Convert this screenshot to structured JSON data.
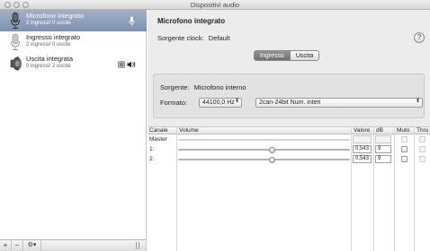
{
  "window": {
    "title": "Dispositivi audio"
  },
  "sidebar": {
    "devices": [
      {
        "name": "Microfono integrato",
        "sub": "2 ingressi/ 0 uscite",
        "icon": "microphone-icon",
        "selected": true
      },
      {
        "name": "Ingresso integrato",
        "sub": "2 ingressi/ 0 uscite",
        "icon": "line-in-icon",
        "selected": false
      },
      {
        "name": "Uscita integrata",
        "sub": "0 ingressi/ 2 uscite",
        "icon": "speaker-icon",
        "selected": false
      }
    ],
    "bottom": {
      "add": "+",
      "remove": "−",
      "gear": "⚙▾"
    }
  },
  "detail": {
    "title": "Microfono integrato",
    "clock_label": "Sorgente clock:",
    "clock_value": "Default",
    "help": "?",
    "tabs": [
      {
        "label": "Ingresso",
        "active": true
      },
      {
        "label": "Uscita",
        "active": false
      }
    ],
    "source_label": "Sorgente:",
    "source_value": "Microfono interno",
    "format_label": "Formato:",
    "rate_value": "44100,0 Hz",
    "format_value": "2can-24bit Num. interi"
  },
  "table": {
    "columns": [
      "Canale",
      "Volume",
      "Valore",
      "dB",
      "Muto",
      "Thru"
    ],
    "rows": [
      {
        "channel": "Master",
        "enabled": false,
        "value": "",
        "db": "",
        "level": 0
      },
      {
        "channel": "1:",
        "enabled": true,
        "value": "0,543",
        "db": "9",
        "level": 0.543
      },
      {
        "channel": "2:",
        "enabled": true,
        "value": "0,543",
        "db": "9",
        "level": 0.543
      }
    ]
  }
}
